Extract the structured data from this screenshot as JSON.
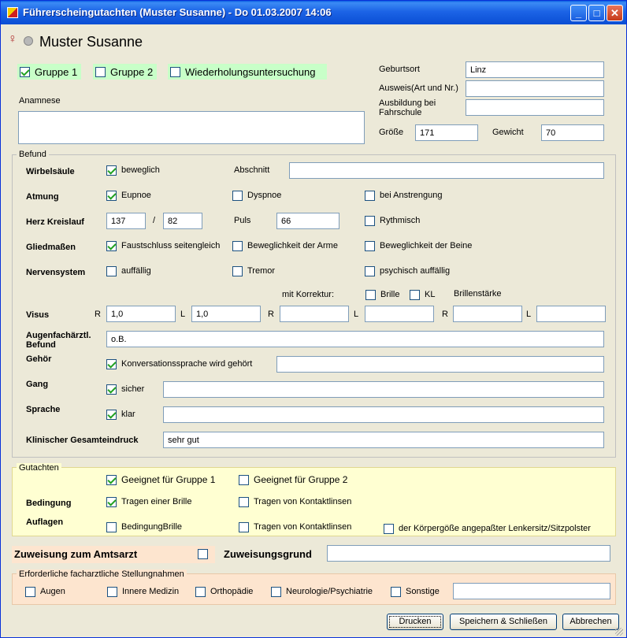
{
  "window": {
    "title": "Führerscheingutachten (Muster Susanne) - Do 01.03.2007 14:06",
    "minimize": "_",
    "maximize": "□",
    "close": "✕"
  },
  "patient": {
    "name": "Muster Susanne",
    "gender_symbol": "♀"
  },
  "groups": {
    "gruppe1": "Gruppe 1",
    "gruppe2": "Gruppe 2",
    "wiederholung": "Wiederholungsuntersuchung"
  },
  "anamnese_label": "Anamnese",
  "personal": {
    "geburtsort_label": "Geburtsort",
    "geburtsort": "Linz",
    "ausweis_label": "Ausweis(Art und Nr.)",
    "ausweis": "",
    "ausbildung_label1": "Ausbildung bei",
    "ausbildung_label2": "Fahrschule",
    "ausbildung": "",
    "groesse_label": "Größe",
    "groesse": "171",
    "gewicht_label": "Gewicht",
    "gewicht": "70"
  },
  "befund": {
    "legend": "Befund",
    "wirbelsaeule": {
      "label": "Wirbelsäule",
      "beweglich": "beweglich",
      "abschnitt_label": "Abschnitt",
      "abschnitt": ""
    },
    "atmung": {
      "label": "Atmung",
      "eupnoe": "Eupnoe",
      "dyspnoe": "Dyspnoe",
      "anstrengung": "bei Anstrengung"
    },
    "herz": {
      "label": "Herz Kreislauf",
      "sys": "137",
      "slash": "/",
      "dia": "82",
      "puls_label": "Puls",
      "puls": "66",
      "rythmisch": "Rythmisch"
    },
    "glieder": {
      "label": "Gliedmaßen",
      "faust": "Faustschluss seitengleich",
      "arme": "Beweglichkeit der Arme",
      "beine": "Beweglichkeit der Beine"
    },
    "nerven": {
      "label": "Nervensystem",
      "auffaellig": "auffällig",
      "tremor": "Tremor",
      "psych": "psychisch auffällig"
    },
    "visus": {
      "label": "Visus",
      "korrektur_label": "mit Korrektur:",
      "brille": "Brille",
      "kl": "KL",
      "staerke_label": "Brillenstärke",
      "r": "R",
      "l": "L",
      "r1": "1,0",
      "l1": "1,0",
      "r2": "",
      "l2": "",
      "r3": "",
      "l3": ""
    },
    "augen": {
      "label1": "Augenfachärztl.",
      "label2": "Befund",
      "value": "o.B."
    },
    "gehoer": {
      "label": "Gehör",
      "cb": "Konversationssprache wird gehört",
      "value": ""
    },
    "gang": {
      "label": "Gang",
      "cb": "sicher",
      "value": ""
    },
    "sprache": {
      "label": "Sprache",
      "cb": "klar",
      "value": ""
    },
    "gesamt": {
      "label": "Klinischer Gesamteindruck",
      "value": "sehr gut"
    }
  },
  "gutachten": {
    "legend": "Gutachten",
    "g1": "Geeignet für Gruppe 1",
    "g2": "Geeignet für Gruppe 2",
    "bedingung_label": "Bedingung",
    "b_brille": "Tragen einer Brille",
    "b_kontakt": "Tragen von Kontaktlinsen",
    "auflagen_label": "Auflagen",
    "a_brille": "BedingungBrille",
    "a_kontakt": "Tragen von Kontaktlinsen",
    "a_sitz": "der Körpergöße angepaßter Lenkersitz/Sitzpolster"
  },
  "zuweisung": {
    "label": "Zuweisung zum Amtsarzt",
    "grund_label": "Zuweisungsgrund",
    "grund": ""
  },
  "facharzt": {
    "legend": "Erforderliche facharztliche Stellungnahmen",
    "augen": "Augen",
    "innere": "Innere Medizin",
    "ortho": "Orthopädie",
    "neuro": "Neurologie/Psychiatrie",
    "sonstige": "Sonstige",
    "sonstige_value": ""
  },
  "buttons": {
    "drucken": "Drucken",
    "speichern": "Speichern & Schließen",
    "abbrechen": "Abbrechen"
  },
  "colors": {
    "green_highlight": "#c8ffc8",
    "yellow_panel": "#ffffd2",
    "orange_panel": "#fde5cf"
  }
}
